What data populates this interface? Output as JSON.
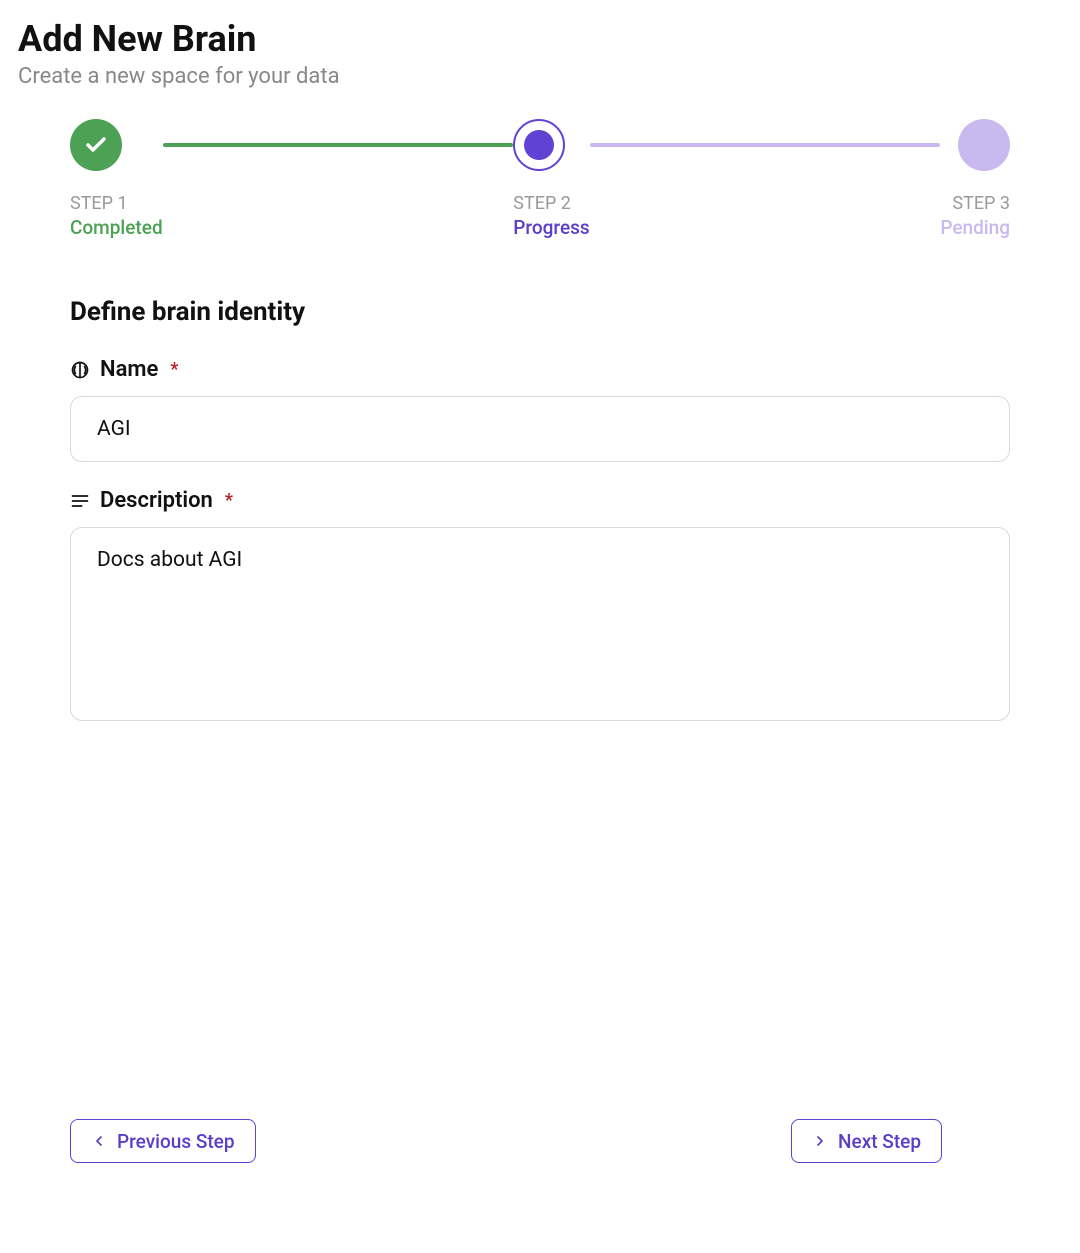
{
  "header": {
    "title": "Add New Brain",
    "subtitle": "Create a new space for your data"
  },
  "stepper": {
    "steps": [
      {
        "label": "STEP 1",
        "status": "Completed",
        "state": "completed"
      },
      {
        "label": "STEP 2",
        "status": "Progress",
        "state": "progress"
      },
      {
        "label": "STEP 3",
        "status": "Pending",
        "state": "pending"
      }
    ]
  },
  "form": {
    "section_title": "Define brain identity",
    "fields": {
      "name": {
        "label": "Name",
        "required_mark": "*",
        "value": "AGI"
      },
      "description": {
        "label": "Description",
        "required_mark": "*",
        "value": "Docs about AGI"
      }
    }
  },
  "footer": {
    "prev_label": "Previous Step",
    "next_label": "Next Step"
  },
  "colors": {
    "completed": "#4ca154",
    "progress": "#6142d4",
    "pending": "#c9b9ee"
  }
}
